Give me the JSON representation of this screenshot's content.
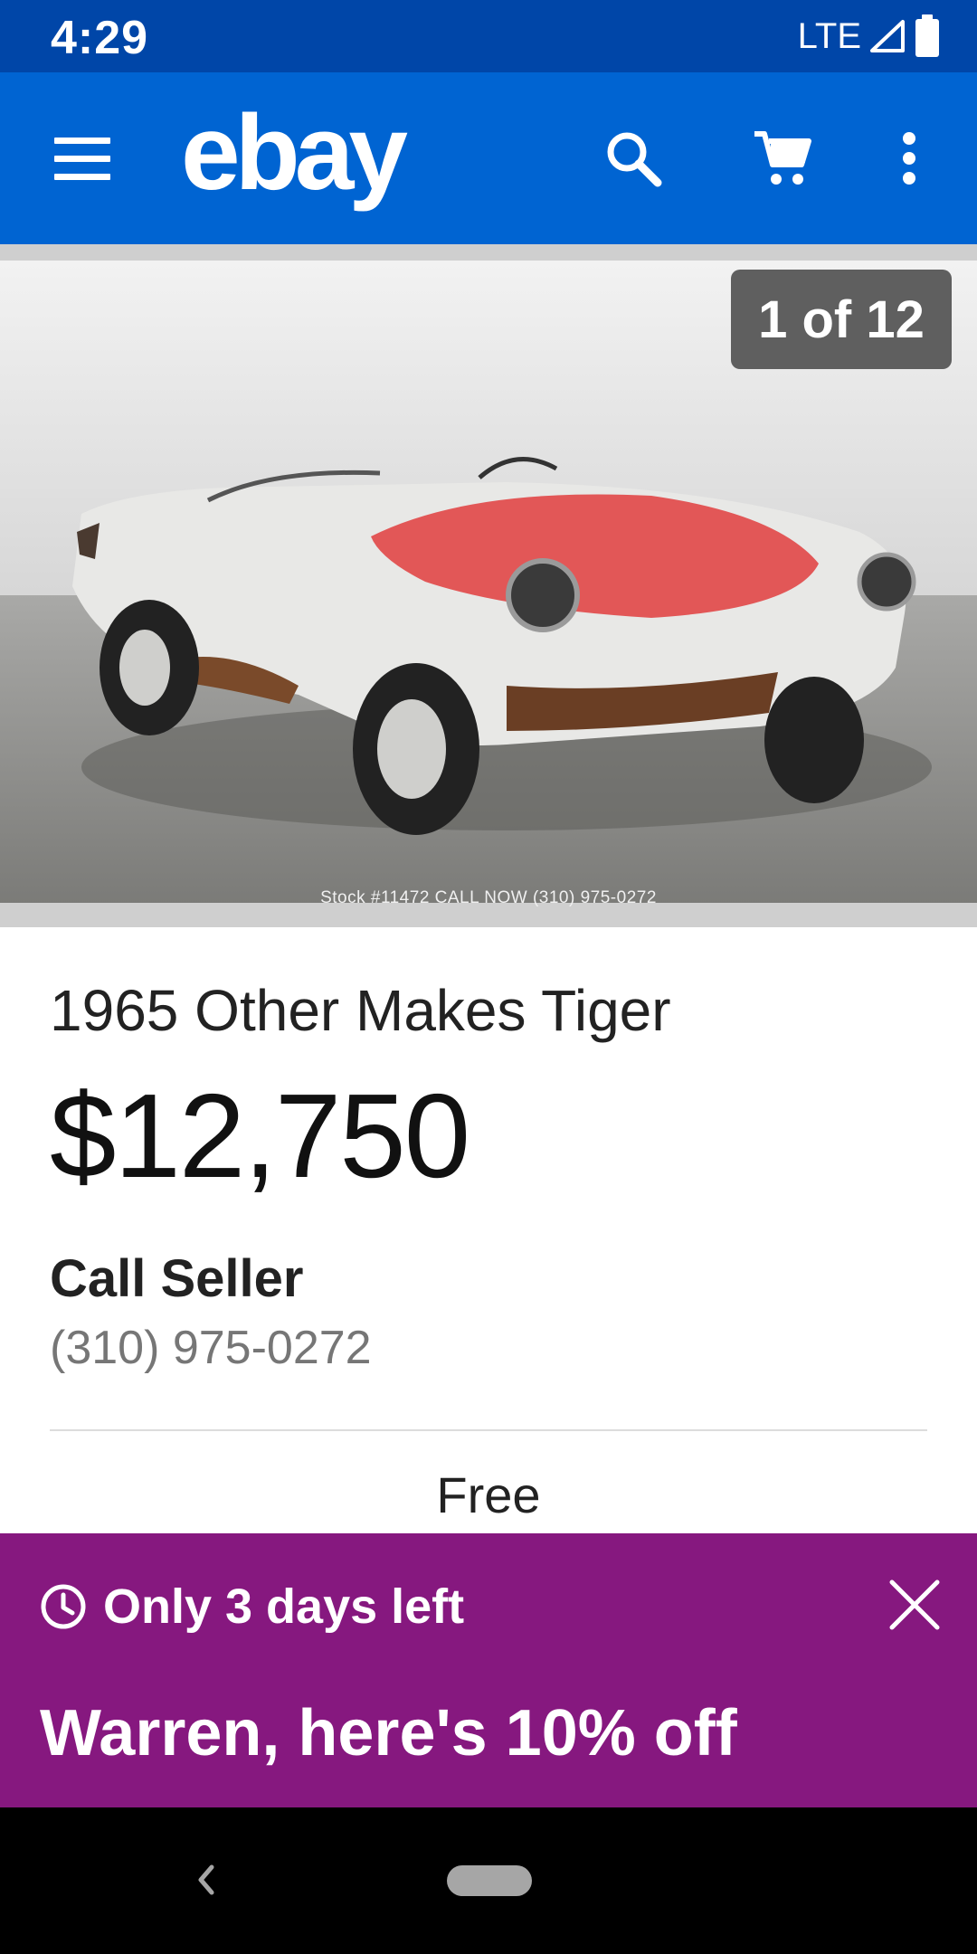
{
  "status_bar": {
    "time": "4:29",
    "network": "LTE"
  },
  "app_bar": {
    "logo": "ebay",
    "menu_icon": "hamburger-menu-icon",
    "search_icon": "search-icon",
    "cart_icon": "cart-icon",
    "overflow_icon": "more-vert-icon",
    "color": "#0064d2"
  },
  "gallery": {
    "counter": "1 of 12",
    "watermark": "Stock #11472 CALL NOW (310) 975-0272"
  },
  "item": {
    "title": "1965 Other Makes Tiger",
    "price": "$12,750",
    "call_label": "Call Seller",
    "phone": "(310) 975-0272",
    "shipping": "Free"
  },
  "promo": {
    "timer_text": "Only 3 days left",
    "offer": "Warren, here's 10% off",
    "color": "#86187f"
  }
}
